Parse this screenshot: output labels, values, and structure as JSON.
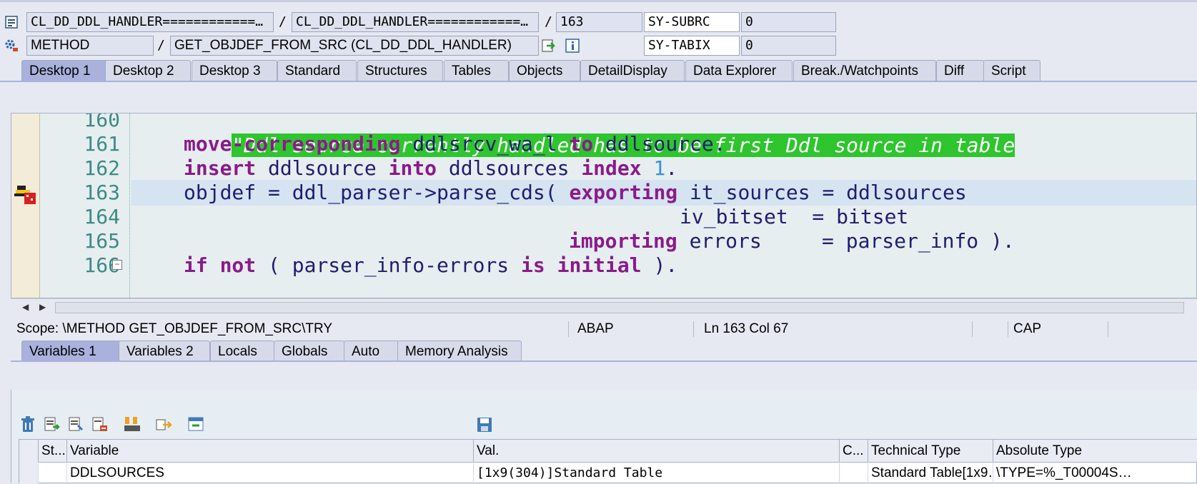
{
  "header": {
    "row1": {
      "program": "CL_DD_DDL_HANDLER============…",
      "include": "CL_DD_DDL_HANDLER============…",
      "line": "163",
      "sysvar1_name": "SY-SUBRC",
      "sysvar1_value": "0"
    },
    "row2": {
      "event_type": "METHOD",
      "event": "GET_OBJDEF_FROM_SRC (CL_DD_DDL_HANDLER)",
      "sysvar2_name": "SY-TABIX",
      "sysvar2_value": "0"
    },
    "slash": "/"
  },
  "desktop_tabs": [
    "Desktop 1",
    "Desktop 2",
    "Desktop 3",
    "Standard",
    "Structures",
    "Tables",
    "Objects",
    "DetailDisplay",
    "Data Explorer",
    "Break./Watchpoints",
    "Diff",
    "Script"
  ],
  "editor": {
    "lines": [
      {
        "num": "160",
        "text": "\"Ddl source currently handled has to be first Ddl source in table"
      },
      {
        "num": "161",
        "kw1": "move-corresponding",
        "t1": " ddlsrcv_wa_l ",
        "kw2": "to",
        "t2": " ddlsource."
      },
      {
        "num": "162",
        "kw1": "insert",
        "t1": " ddlsource ",
        "kw2": "into",
        "t2": " ddlsources ",
        "kw3": "index",
        "n": " 1",
        "t3": "."
      },
      {
        "num": "163",
        "t1": "objdef = ddl_parser->parse_cds( ",
        "kw1": "exporting",
        "t2": " it_sources = ddlsources"
      },
      {
        "num": "164",
        "t1": "iv_bitset  = bitset"
      },
      {
        "num": "165",
        "kw1": "importing",
        "t1": " errors     = parser_info )."
      },
      {
        "num": "166",
        "kw1": "if not",
        "t1": " ( parser_info-errors ",
        "kw2": "is initial",
        "t2": " )."
      }
    ],
    "collapse_symbol": "−"
  },
  "status_bar": {
    "scope": "Scope: \\METHOD GET_OBJDEF_FROM_SRC\\TRY",
    "language": "ABAP",
    "position": "Ln 163 Col  67",
    "caps": "CAP"
  },
  "variable_tabs": [
    "Variables 1",
    "Variables 2",
    "Locals",
    "Globals",
    "Auto",
    "Memory Analysis"
  ],
  "grid": {
    "columns": [
      "St...",
      "Variable",
      "Val.",
      "C...",
      "Technical Type",
      "Absolute Type"
    ],
    "rows": [
      {
        "status": "",
        "variable": "DDLSOURCES",
        "value": "[1x9(304)]Standard Table",
        "c": "",
        "technical_type": "Standard Table[1x9…",
        "absolute_type": "\\TYPE=%_T00004S…"
      }
    ]
  },
  "colors": {
    "active_tab": "#a9b1dc",
    "comment_bg": "#2ec52e",
    "keyword": "#8b1a8a",
    "line_number": "#3c8a86"
  }
}
